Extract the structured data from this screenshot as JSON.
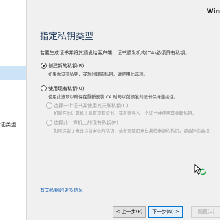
{
  "window": {
    "title_partial": "Win"
  },
  "sidebar": {
    "items": [
      {
        "label": "证类型"
      }
    ]
  },
  "page": {
    "heading": "指定私钥类型",
    "intro": "若要生成证书并将其颁发给客户端，证书颁发机构(CA)必须具有私钥。"
  },
  "options": [
    {
      "label": "创建新的私钥(R)",
      "desc": "如果你没有私钥，或想创建新私钥，请使用此选项。",
      "selected": true
    },
    {
      "label": "使用现有私钥(U)",
      "desc": "使用此选项以确保在重新安装 CA 时与以前颁发的证书保持连续性。",
      "selected": false
    }
  ],
  "suboptions": [
    {
      "label": "选择一个证书并使用其关联私钥(C)",
      "desc": "如果在此计算机上具有现有证书，或者要导入一个证书并使用其关联私钥，"
    },
    {
      "label": "选择此计算机上的现有私钥(E)",
      "desc": "如果保留了来自以前安装的私钥，或者要使用来自其他来源的私钥，请选择此选项"
    }
  ],
  "footer_link": "有关私钥的更多信息",
  "buttons": {
    "back": "< 上一步(P)",
    "next": "下一步(N) >",
    "configure": "配置(C)"
  }
}
